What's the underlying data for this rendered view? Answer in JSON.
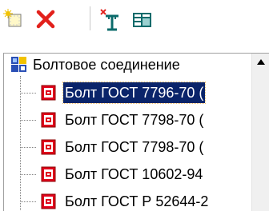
{
  "toolbar": {
    "buttons": [
      {
        "name": "new-item-icon"
      },
      {
        "name": "delete-icon"
      },
      {
        "name": "insert-attribute-icon"
      },
      {
        "name": "table-view-icon"
      }
    ]
  },
  "tree": {
    "root": {
      "label": "Болтовое соединение",
      "icon": "assembly-icon"
    },
    "items": [
      {
        "label": "Болт ГОСТ 7796-70 (",
        "selected": true,
        "icon": "part-icon"
      },
      {
        "label": "Болт ГОСТ 7798-70 (",
        "selected": false,
        "icon": "part-icon"
      },
      {
        "label": "Болт ГОСТ 7798-70 (",
        "selected": false,
        "icon": "part-icon"
      },
      {
        "label": "Болт ГОСТ 10602-94",
        "selected": false,
        "icon": "part-icon"
      },
      {
        "label": "Болт ГОСТ Р 52644-2",
        "selected": false,
        "icon": "part-icon"
      }
    ]
  },
  "colors": {
    "selection": "#0a246a",
    "part_icon_red": "#e0001b",
    "delete_red": "#e2211c"
  }
}
